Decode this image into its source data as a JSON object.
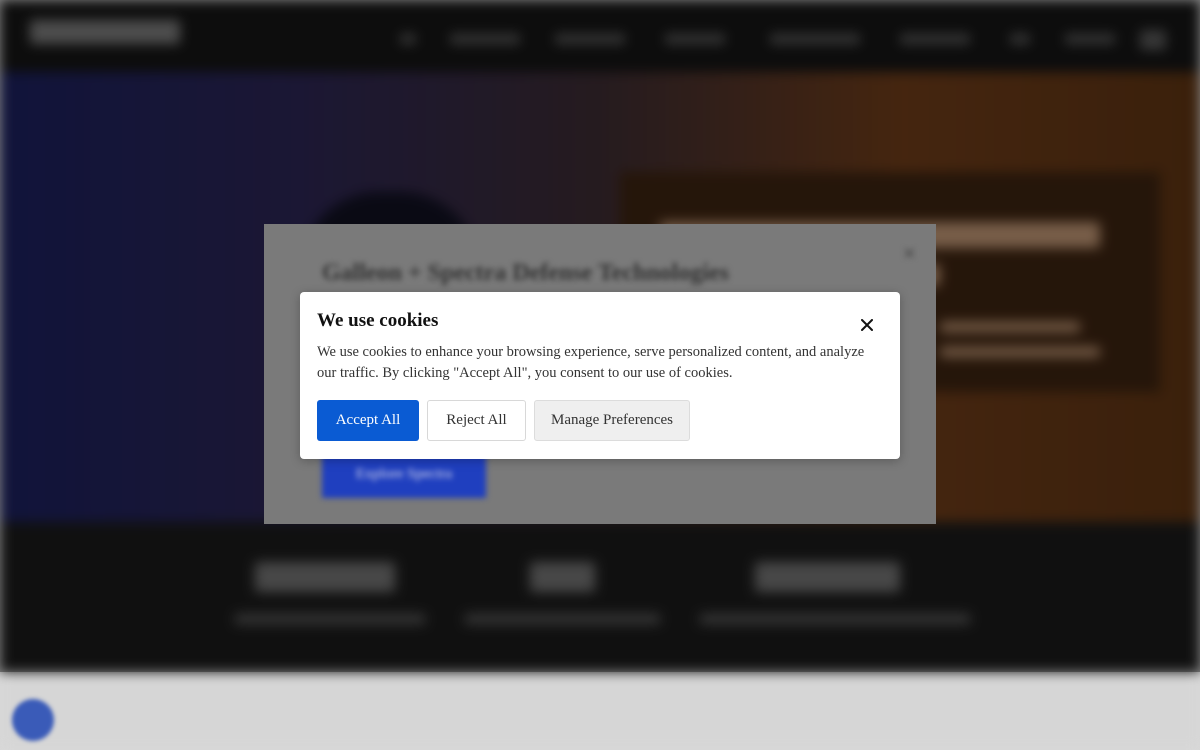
{
  "background_modal": {
    "title": "Galleon + Spectra Defense Technologies",
    "close_icon": "close-icon",
    "cta_label": "Explore Spectra"
  },
  "cookie_banner": {
    "title": "We use cookies",
    "message": "We use cookies to enhance your browsing experience, serve personalized content, and analyze our traffic. By clicking \"Accept All\", you consent to our use of cookies.",
    "close_icon": "close-icon",
    "buttons": {
      "accept": "Accept All",
      "reject": "Reject All",
      "manage": "Manage Preferences"
    },
    "accent_color": "#0a5bd3"
  },
  "chat_widget": {
    "icon": "chat-icon"
  }
}
